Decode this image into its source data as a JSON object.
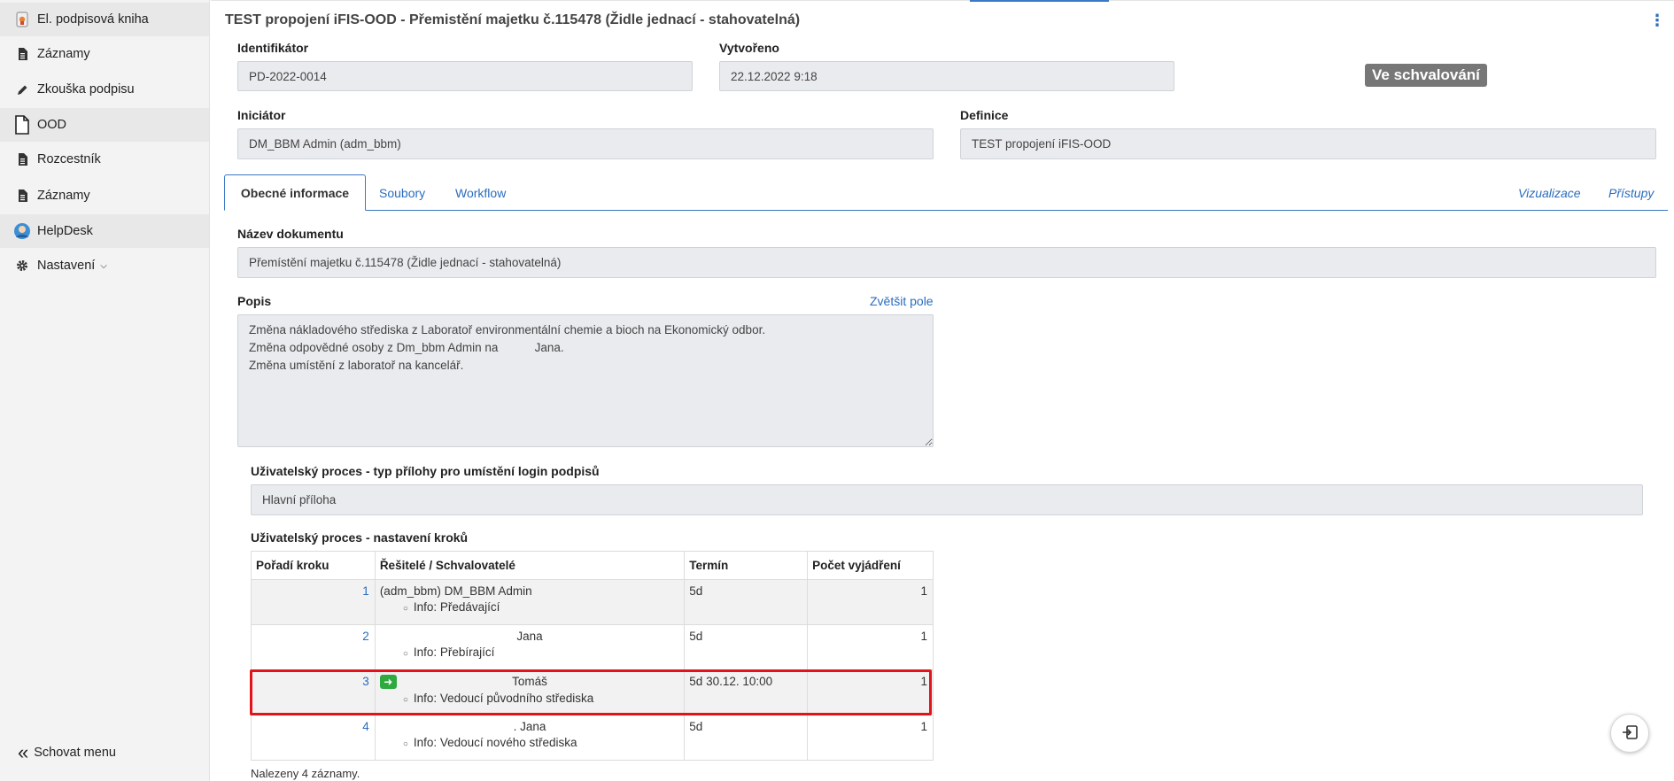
{
  "sidebar": {
    "items": [
      {
        "label": "El. podpisová kniha",
        "icon": "signature-book-icon",
        "section": true
      },
      {
        "label": "Záznamy",
        "icon": "document-icon",
        "section": false
      },
      {
        "label": "Zkouška podpisu",
        "icon": "pencil-icon",
        "section": false
      },
      {
        "label": "OOD",
        "icon": "file-icon",
        "section": true
      },
      {
        "label": "Rozcestník",
        "icon": "document-icon",
        "section": false
      },
      {
        "label": "Záznamy",
        "icon": "document-icon",
        "section": false
      },
      {
        "label": "HelpDesk",
        "icon": "helpdesk-icon",
        "section": true
      },
      {
        "label": "Nastavení",
        "icon": "gear-icon",
        "section": false
      }
    ],
    "hide_label": "Schovat menu"
  },
  "header": {
    "title": "TEST propojení iFIS-OOD - Přemistění majetku č.115478 (Židle jednací - stahovatelná)"
  },
  "fields": {
    "identifikator_label": "Identifikátor",
    "identifikator_value": "PD-2022-0014",
    "vytvoreno_label": "Vytvořeno",
    "vytvoreno_value": "22.12.2022 9:18",
    "status": "Ve schvalování",
    "iniciator_label": "Iniciátor",
    "iniciator_value": "DM_BBM Admin (adm_bbm)",
    "definice_label": "Definice",
    "definice_value": "TEST propojení iFIS-OOD"
  },
  "tabs": {
    "general": "Obecné informace",
    "files": "Soubory",
    "workflow": "Workflow",
    "visualization": "Vizualizace",
    "access": "Přístupy"
  },
  "document": {
    "name_label": "Název dokumentu",
    "name_value": "Přemístění majetku č.115478 (Židle jednací - stahovatelná)",
    "popis_label": "Popis",
    "enlarge_link": "Zvětšit pole",
    "popis_value": "Změna nákladového střediska z Laboratoř environmentální chemie a bioch na Ekonomický odbor.\nZměna odpovědné osoby z Dm_bbm Admin na           Jana.\nZměna umístění z laboratoř na kancelář.",
    "attachment_label": "Uživatelský proces - typ přílohy pro umístění login podpisů",
    "attachment_value": "Hlavní příloha",
    "steps_label": "Uživatelský proces - nastavení kroků"
  },
  "steps_table": {
    "headers": [
      "Pořadí kroku",
      "Řešitelé / Schvalovatelé",
      "Termín",
      "Počet vyjádření"
    ],
    "rows": [
      {
        "order": "1",
        "resolver": "(adm_bbm) DM_BBM Admin",
        "info": "Info: Předávající",
        "term": "5d",
        "count": "1"
      },
      {
        "order": "2",
        "resolver": "Jana",
        "info": "Info: Přebírající",
        "term": "5d",
        "count": "1"
      },
      {
        "order": "3",
        "resolver": "Tomáš",
        "info": "Info: Vedoucí původního střediska",
        "term": "5d 30.12. 10:00",
        "count": "1"
      },
      {
        "order": "4",
        "resolver": ". Jana",
        "info": "Info: Vedoucí nového střediska",
        "term": "5d",
        "count": "1"
      }
    ],
    "found": "Nalezeny 4 záznamy."
  },
  "colors": {
    "accent": "#2a6cbf",
    "highlight": "#e3131a",
    "badge": "#777777",
    "current_step": "#2eaa3f"
  }
}
